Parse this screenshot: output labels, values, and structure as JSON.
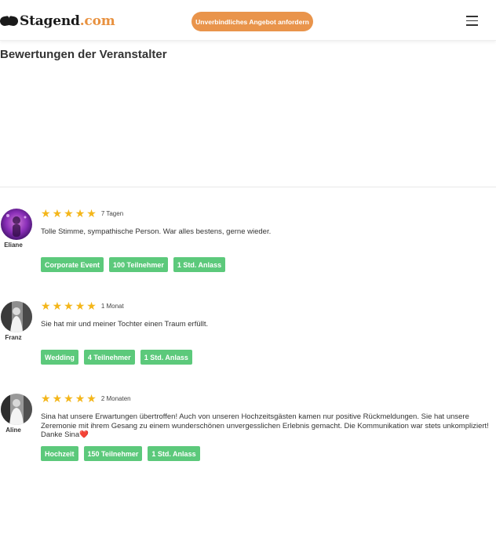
{
  "header": {
    "logo_name": "Stagend",
    "logo_tld": ".com",
    "cta_label": "Unverbindliches Angebot anfordern",
    "menu_icon": "hamburger-menu-icon"
  },
  "section": {
    "title": "Bewertungen der Veranstalter"
  },
  "colors": {
    "accent": "#e9944b",
    "tag": "#5cc97b",
    "star": "#f4b61a"
  },
  "reviews": [
    {
      "name": "Eliane",
      "rating": 5,
      "time": "7 Tagen",
      "text": "Tolle Stimme, sympathische Person. War alles bestens, gerne wieder.",
      "tags": [
        "Corporate Event",
        "100 Teilnehmer",
        "1 Std. Anlass"
      ]
    },
    {
      "name": "Franz",
      "rating": 5,
      "time": "1 Monat",
      "text": "Sie hat mir und meiner Tochter einen Traum erfüllt.",
      "tags": [
        "Wedding",
        "4 Teilnehmer",
        "1 Std. Anlass"
      ]
    },
    {
      "name": "Aline",
      "rating": 5,
      "time": "2 Monaten",
      "text": "Sina hat unsere Erwartungen übertroffen! Auch von unseren Hochzeitsgästen kamen nur positive Rückmeldungen. Sie hat unsere Zeremonie mit ihrem Gesang zu einem wunderschönen unvergesslichen Erlebnis gemacht. Die Kommunikation war stets unkompliziert! Danke Sina❤️",
      "tags": [
        "Hochzeit",
        "150 Teilnehmer",
        "1 Std. Anlass"
      ]
    }
  ]
}
